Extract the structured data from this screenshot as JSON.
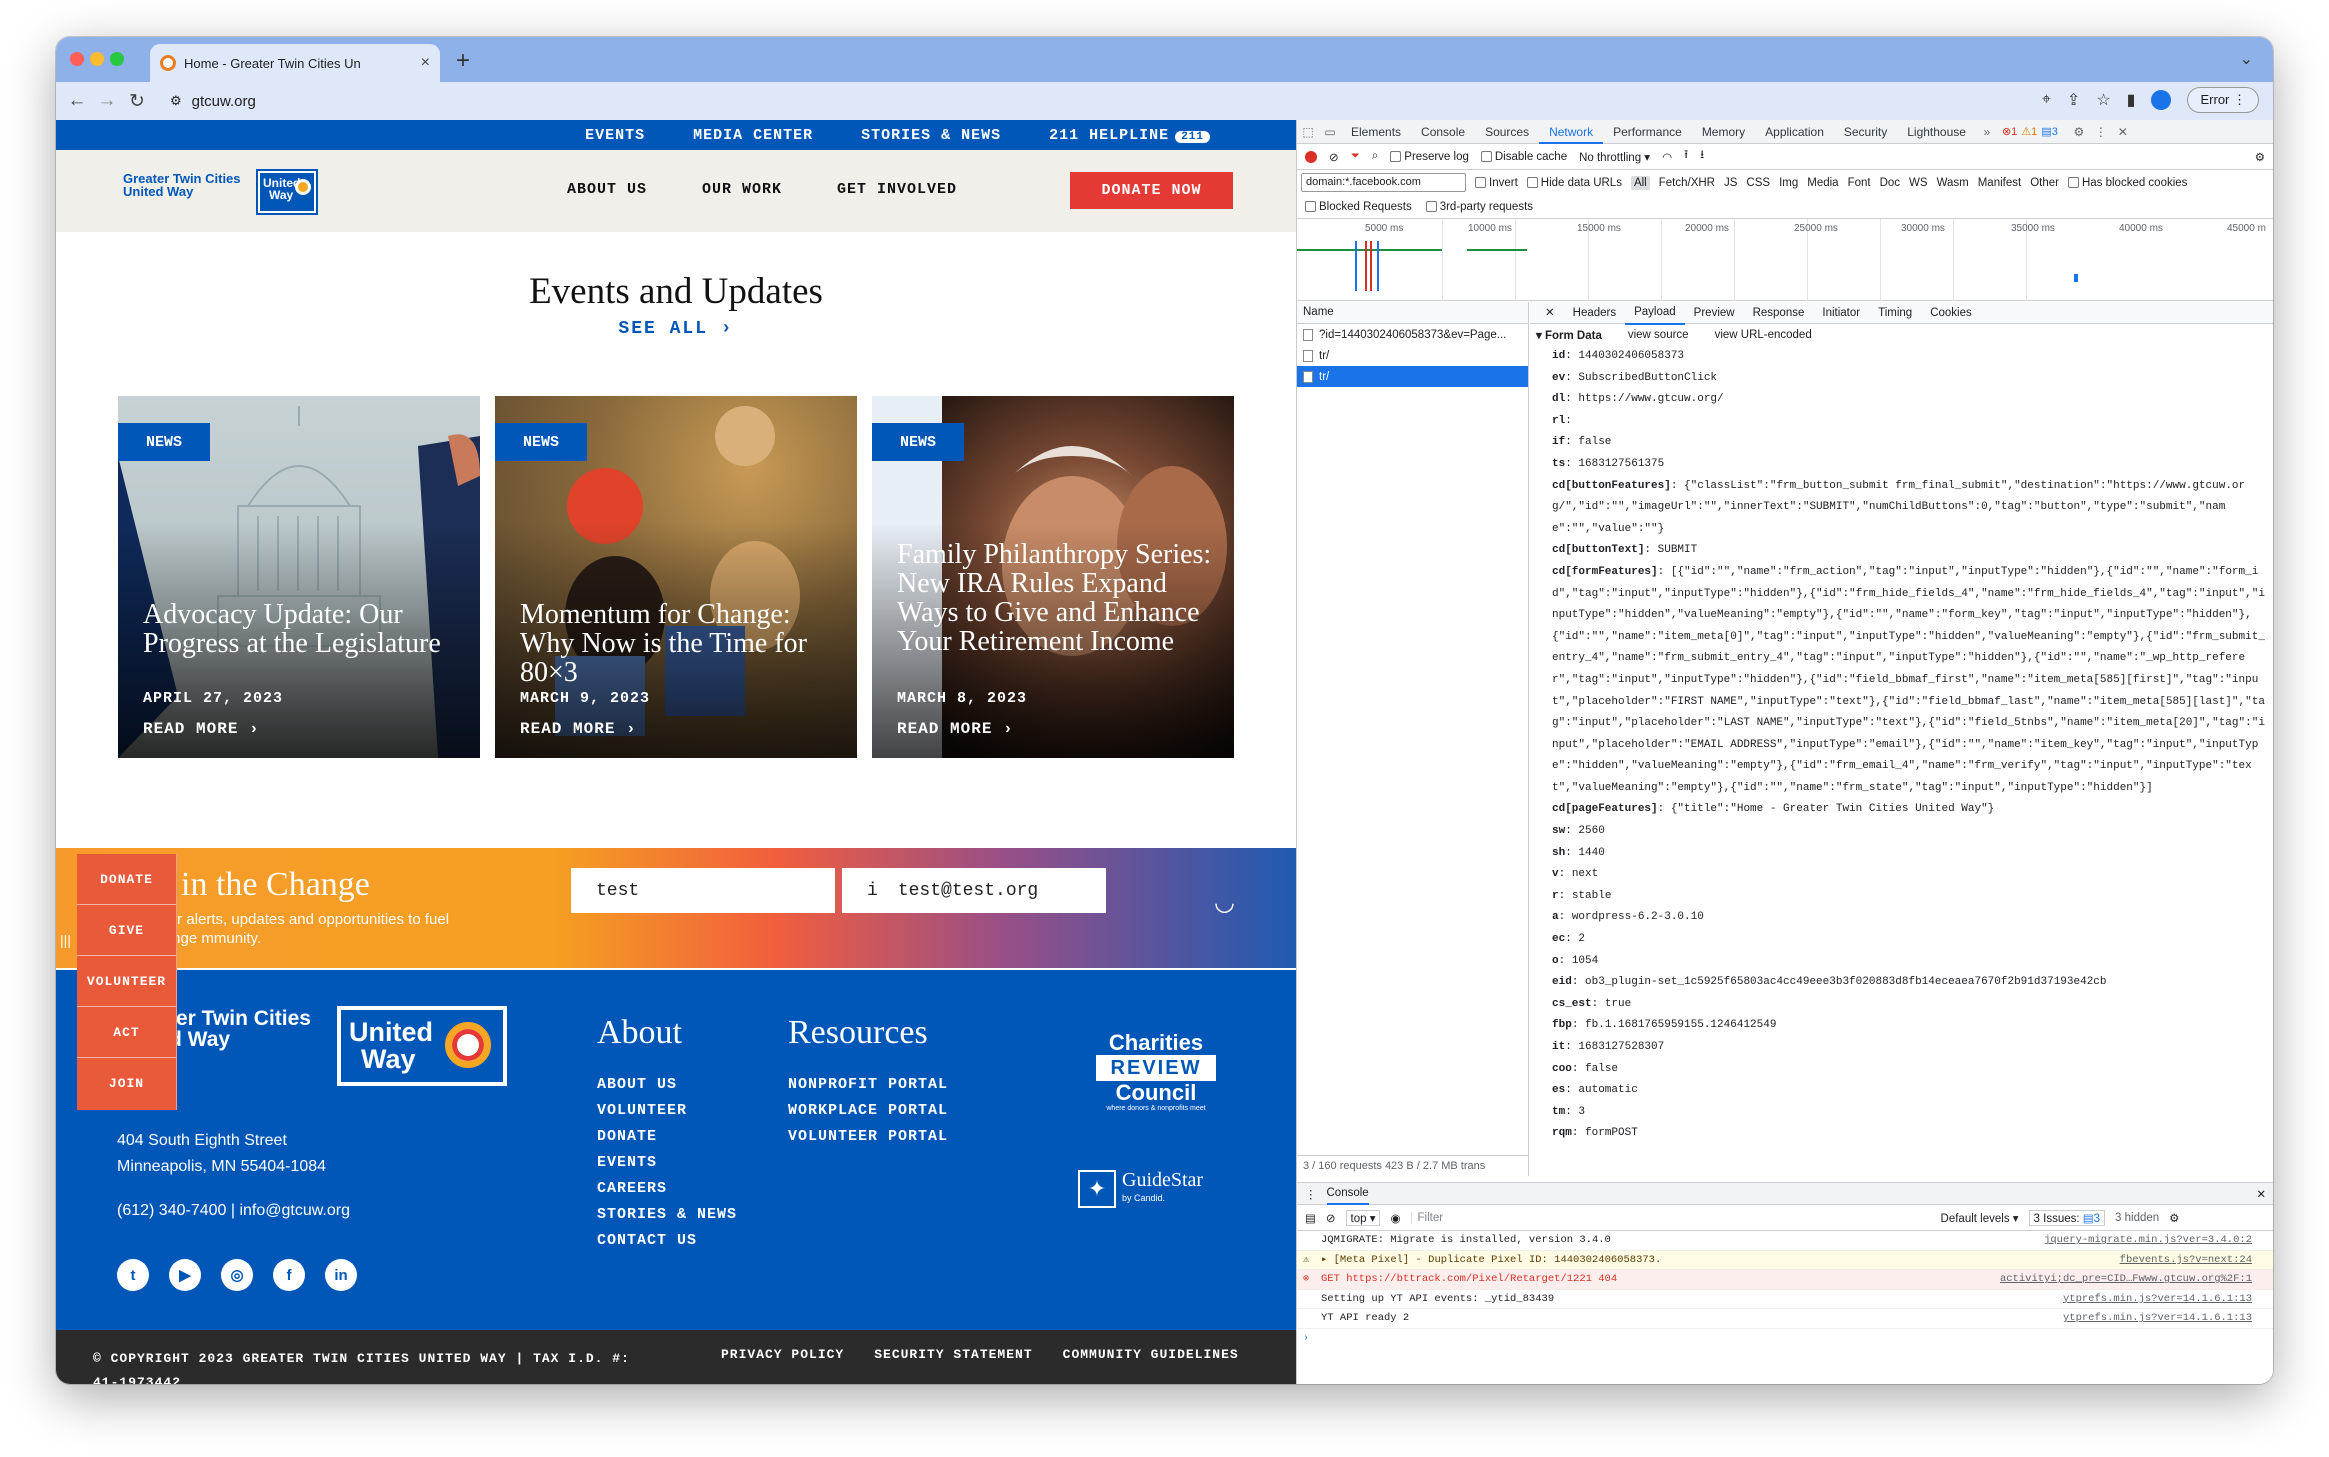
{
  "browser": {
    "tab_title": "Home - Greater Twin Cities Un",
    "url": "gtcuw.org",
    "error_button": "Error"
  },
  "site": {
    "topnav": [
      "EVENTS",
      "MEDIA CENTER",
      "STORIES & NEWS",
      "211 HELPLINE"
    ],
    "helpline_badge": "211",
    "logo_text_1": "Greater Twin Cities",
    "logo_text_2": "United Way",
    "logo_mark_1": "United",
    "logo_mark_2": "Way",
    "mainnav": [
      "ABOUT US",
      "OUR WORK",
      "GET INVOLVED"
    ],
    "donate_label": "DONATE NOW",
    "events_title": "Events and Updates",
    "see_all": "SEE ALL ›",
    "cards": [
      {
        "tag": "NEWS",
        "headline": "Advocacy Update: Our Progress at the Legislature",
        "date": "APRIL 27, 2023",
        "more": "READ MORE ›"
      },
      {
        "tag": "NEWS",
        "headline": "Momentum for Change: Why Now is the Time for 80×3",
        "date": "MARCH 9, 2023",
        "more": "READ MORE ›"
      },
      {
        "tag": "NEWS",
        "headline": "Family Philanthropy Series: New IRA Rules Expand Ways to Give and Enhance Your Retirement Income",
        "date": "MARCH 8, 2023",
        "more": "READ MORE ›"
      }
    ],
    "signup": {
      "heading": "te in the Change",
      "sub": "to for alerts, updates and opportunities to fuel change mmunity.",
      "name_value": "test",
      "email_value": "test@test.org",
      "email_prefix": "i"
    },
    "side_tabs": [
      "DONATE",
      "GIVE",
      "VOLUNTEER",
      "ACT",
      "JOIN"
    ],
    "footer": {
      "logo_text_1": "ter Twin Cities",
      "logo_text_2": "d Way",
      "address_1": "404 South Eighth Street",
      "address_2": "Minneapolis, MN 55404-1084",
      "contact": "(612) 340-7400 | info@gtcuw.org",
      "about_title": "About",
      "about_links": [
        "ABOUT US",
        "VOLUNTEER",
        "DONATE",
        "EVENTS",
        "CAREERS",
        "STORIES & NEWS",
        "CONTACT US"
      ],
      "resources_title": "Resources",
      "resources_links": [
        "NONPROFIT PORTAL",
        "WORKPLACE PORTAL",
        "VOLUNTEER PORTAL"
      ],
      "crc_1": "Charities",
      "crc_2": "REVIEW",
      "crc_3": "Council",
      "crc_4": "where donors & nonprofits meet",
      "guidestar": "GuideStar",
      "guidestar_sub": "by Candid.",
      "social": [
        "twitter-icon",
        "youtube-icon",
        "instagram-icon",
        "facebook-icon",
        "linkedin-icon"
      ]
    },
    "copyright": "© COPYRIGHT 2023 GREATER TWIN CITIES UNITED WAY | TAX I.D. #: 41-1973442",
    "legal_links": [
      "PRIVACY POLICY",
      "SECURITY STATEMENT",
      "COMMUNITY GUIDELINES"
    ]
  },
  "devtools": {
    "tabs": [
      "Elements",
      "Console",
      "Sources",
      "Network",
      "Performance",
      "Memory",
      "Application",
      "Security",
      "Lighthouse"
    ],
    "badges": {
      "errors": "1",
      "warnings": "1",
      "messages": "3"
    },
    "preserve_log": "Preserve log",
    "disable_cache": "Disable cache",
    "throttling": "No throttling",
    "filter_value": "domain:*.facebook.com",
    "invert": "Invert",
    "hide_data_urls": "Hide data URLs",
    "types": [
      "All",
      "Fetch/XHR",
      "JS",
      "CSS",
      "Img",
      "Media",
      "Font",
      "Doc",
      "WS",
      "Wasm",
      "Manifest",
      "Other"
    ],
    "has_blocked_cookies": "Has blocked cookies",
    "blocked_requests": "Blocked Requests",
    "third_party": "3rd-party requests",
    "timeline_ticks": [
      "5000 ms",
      "10000 ms",
      "15000 ms",
      "20000 ms",
      "25000 ms",
      "30000 ms",
      "35000 ms",
      "40000 ms",
      "45000 m"
    ],
    "name_header": "Name",
    "requests": [
      "?id=1440302406058373&ev=Page...",
      "tr/",
      "tr/"
    ],
    "status_bar": "3 / 160 requests   423 B / 2.7 MB trans",
    "detail_tabs": [
      "Headers",
      "Payload",
      "Preview",
      "Response",
      "Initiator",
      "Timing",
      "Cookies"
    ],
    "form_data_label": "▾ Form Data",
    "view_source": "view source",
    "view_url_encoded": "view URL-encoded",
    "form_data": [
      {
        "k": "id",
        "v": "1440302406058373"
      },
      {
        "k": "ev",
        "v": "SubscribedButtonClick"
      },
      {
        "k": "dl",
        "v": "https://www.gtcuw.org/"
      },
      {
        "k": "rl",
        "v": ""
      },
      {
        "k": "if",
        "v": "false"
      },
      {
        "k": "ts",
        "v": "1683127561375"
      },
      {
        "k": "cd[buttonFeatures]",
        "v": "{\"classList\":\"frm_button_submit frm_final_submit\",\"destination\":\"https://www.gtcuw.org/\",\"id\":\"\",\"imageUrl\":\"\",\"innerText\":\"SUBMIT\",\"numChildButtons\":0,\"tag\":\"button\",\"type\":\"submit\",\"name\":\"\",\"value\":\"\"}"
      },
      {
        "k": "cd[buttonText]",
        "v": "SUBMIT"
      },
      {
        "k": "cd[formFeatures]",
        "v": "[{\"id\":\"\",\"name\":\"frm_action\",\"tag\":\"input\",\"inputType\":\"hidden\"},{\"id\":\"\",\"name\":\"form_id\",\"tag\":\"input\",\"inputType\":\"hidden\"},{\"id\":\"frm_hide_fields_4\",\"name\":\"frm_hide_fields_4\",\"tag\":\"input\",\"inputType\":\"hidden\",\"valueMeaning\":\"empty\"},{\"id\":\"\",\"name\":\"form_key\",\"tag\":\"input\",\"inputType\":\"hidden\"},{\"id\":\"\",\"name\":\"item_meta[0]\",\"tag\":\"input\",\"inputType\":\"hidden\",\"valueMeaning\":\"empty\"},{\"id\":\"frm_submit_entry_4\",\"name\":\"frm_submit_entry_4\",\"tag\":\"input\",\"inputType\":\"hidden\"},{\"id\":\"\",\"name\":\"_wp_http_referer\",\"tag\":\"input\",\"inputType\":\"hidden\"},{\"id\":\"field_bbmaf_first\",\"name\":\"item_meta[585][first]\",\"tag\":\"input\",\"placeholder\":\"FIRST NAME\",\"inputType\":\"text\"},{\"id\":\"field_bbmaf_last\",\"name\":\"item_meta[585][last]\",\"tag\":\"input\",\"placeholder\":\"LAST NAME\",\"inputType\":\"text\"},{\"id\":\"field_5tnbs\",\"name\":\"item_meta[20]\",\"tag\":\"input\",\"placeholder\":\"EMAIL ADDRESS\",\"inputType\":\"email\"},{\"id\":\"\",\"name\":\"item_key\",\"tag\":\"input\",\"inputType\":\"hidden\",\"valueMeaning\":\"empty\"},{\"id\":\"frm_email_4\",\"name\":\"frm_verify\",\"tag\":\"input\",\"inputType\":\"text\",\"valueMeaning\":\"empty\"},{\"id\":\"\",\"name\":\"frm_state\",\"tag\":\"input\",\"inputType\":\"hidden\"}]"
      },
      {
        "k": "cd[pageFeatures]",
        "v": "{\"title\":\"Home - Greater Twin Cities United Way\"}"
      },
      {
        "k": "sw",
        "v": "2560"
      },
      {
        "k": "sh",
        "v": "1440"
      },
      {
        "k": "v",
        "v": "next"
      },
      {
        "k": "r",
        "v": "stable"
      },
      {
        "k": "a",
        "v": "wordpress-6.2-3.0.10"
      },
      {
        "k": "ec",
        "v": "2"
      },
      {
        "k": "o",
        "v": "1054"
      },
      {
        "k": "eid",
        "v": "ob3_plugin-set_1c5925f65803ac4cc49eee3b3f020883d8fb14eceaea7670f2b91d37193e42cb"
      },
      {
        "k": "cs_est",
        "v": "true"
      },
      {
        "k": "fbp",
        "v": "fb.1.1681765959155.1246412549"
      },
      {
        "k": "it",
        "v": "1683127528307"
      },
      {
        "k": "coo",
        "v": "false"
      },
      {
        "k": "es",
        "v": "automatic"
      },
      {
        "k": "tm",
        "v": "3"
      },
      {
        "k": "rqm",
        "v": "formPOST"
      }
    ],
    "console": {
      "tab": "Console",
      "context": "top",
      "filter_placeholder": "Filter",
      "levels": "Default levels ▾",
      "issues": "3 Issues: ",
      "issues_count": "3",
      "hidden": "3 hidden",
      "lines": [
        {
          "type": "log",
          "msg": "JQMIGRATE: Migrate is installed, version 3.4.0",
          "src": "jquery-migrate.min.js?ver=3.4.0:2"
        },
        {
          "type": "warn",
          "msg": "▸ [Meta Pixel] - Duplicate Pixel ID: 1440302406058373.",
          "src": "fbevents.js?v=next:24"
        },
        {
          "type": "err",
          "msg": "GET https://bttrack.com/Pixel/Retarget/1221 404",
          "src": "activityi;dc_pre=CID…Fwww.gtcuw.org%2F:1"
        },
        {
          "type": "log",
          "msg": "Setting up YT API events: _ytid_83439",
          "src": "ytprefs.min.js?ver=14.1.6.1:13"
        },
        {
          "type": "log",
          "msg": "YT API ready 2",
          "src": "ytprefs.min.js?ver=14.1.6.1:13"
        }
      ]
    }
  }
}
